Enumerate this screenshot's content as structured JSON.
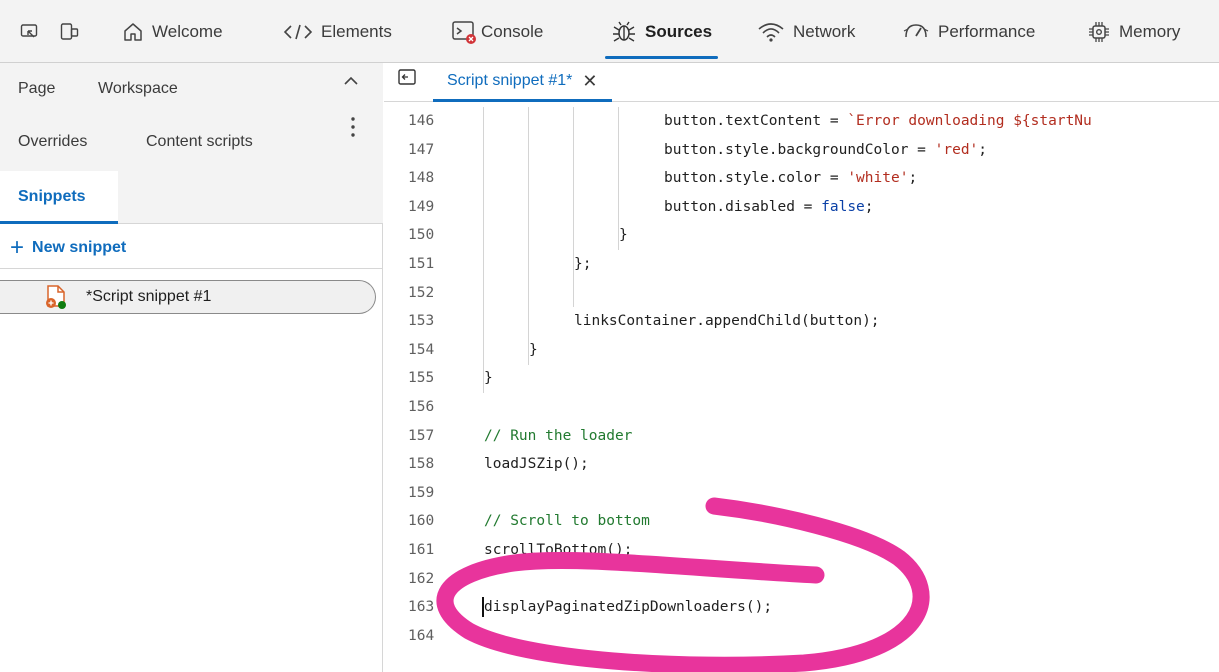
{
  "toolbar": {
    "tabs": [
      {
        "label": "Welcome",
        "icon": "home-icon"
      },
      {
        "label": "Elements",
        "icon": "code-icon"
      },
      {
        "label": "Console",
        "icon": "console-icon"
      },
      {
        "label": "Sources",
        "icon": "bug-icon",
        "active": true
      },
      {
        "label": "Network",
        "icon": "wifi-icon"
      },
      {
        "label": "Performance",
        "icon": "performance-icon"
      },
      {
        "label": "Memory",
        "icon": "memory-icon"
      }
    ]
  },
  "navigator": {
    "tabs": [
      "Page",
      "Workspace",
      "Overrides",
      "Content scripts",
      "Snippets"
    ],
    "active_tab": "Snippets",
    "new_snippet_label": "New snippet",
    "files": [
      "*Script snippet #1"
    ]
  },
  "editor": {
    "tab_label": "Script snippet #1*",
    "close_label": "✕",
    "lines": [
      {
        "n": "146",
        "segs": [
          [
            "button.textContent = ",
            ""
          ],
          [
            "`Error downloading ${startNu",
            "str"
          ]
        ]
      },
      {
        "n": "147",
        "segs": [
          [
            "button.style.backgroundColor = ",
            ""
          ],
          [
            "'red'",
            "str"
          ],
          [
            ";",
            ""
          ]
        ]
      },
      {
        "n": "148",
        "segs": [
          [
            "button.style.color = ",
            ""
          ],
          [
            "'white'",
            "str"
          ],
          [
            ";",
            ""
          ]
        ]
      },
      {
        "n": "149",
        "segs": [
          [
            "button.disabled = ",
            ""
          ],
          [
            "false",
            "kw"
          ],
          [
            ";",
            ""
          ]
        ]
      },
      {
        "n": "150",
        "segs": [
          [
            "}",
            ""
          ]
        ]
      },
      {
        "n": "151",
        "segs": [
          [
            "};",
            ""
          ]
        ]
      },
      {
        "n": "152",
        "segs": []
      },
      {
        "n": "153",
        "segs": [
          [
            "linksContainer.appendChild(button);",
            ""
          ]
        ]
      },
      {
        "n": "154",
        "segs": [
          [
            "}",
            ""
          ]
        ]
      },
      {
        "n": "155",
        "segs": [
          [
            "}",
            ""
          ]
        ]
      },
      {
        "n": "156",
        "segs": []
      },
      {
        "n": "157",
        "segs": [
          [
            "// Run the loader",
            "cm"
          ]
        ]
      },
      {
        "n": "158",
        "segs": [
          [
            "loadJSZip();",
            ""
          ]
        ]
      },
      {
        "n": "159",
        "segs": []
      },
      {
        "n": "160",
        "segs": [
          [
            "// Scroll to bottom",
            "cm"
          ]
        ]
      },
      {
        "n": "161",
        "segs": [
          [
            "scrollToBottom();",
            ""
          ]
        ]
      },
      {
        "n": "162",
        "segs": []
      },
      {
        "n": "163",
        "segs": [
          [
            "displayPaginatedZipDownloaders();",
            ""
          ]
        ]
      },
      {
        "n": "164",
        "segs": []
      }
    ]
  },
  "colors": {
    "accent": "#0f6cbd",
    "annotation": "#e8349c",
    "string": "#b22d1f",
    "keyword": "#0b41a7",
    "comment": "#227a30"
  }
}
